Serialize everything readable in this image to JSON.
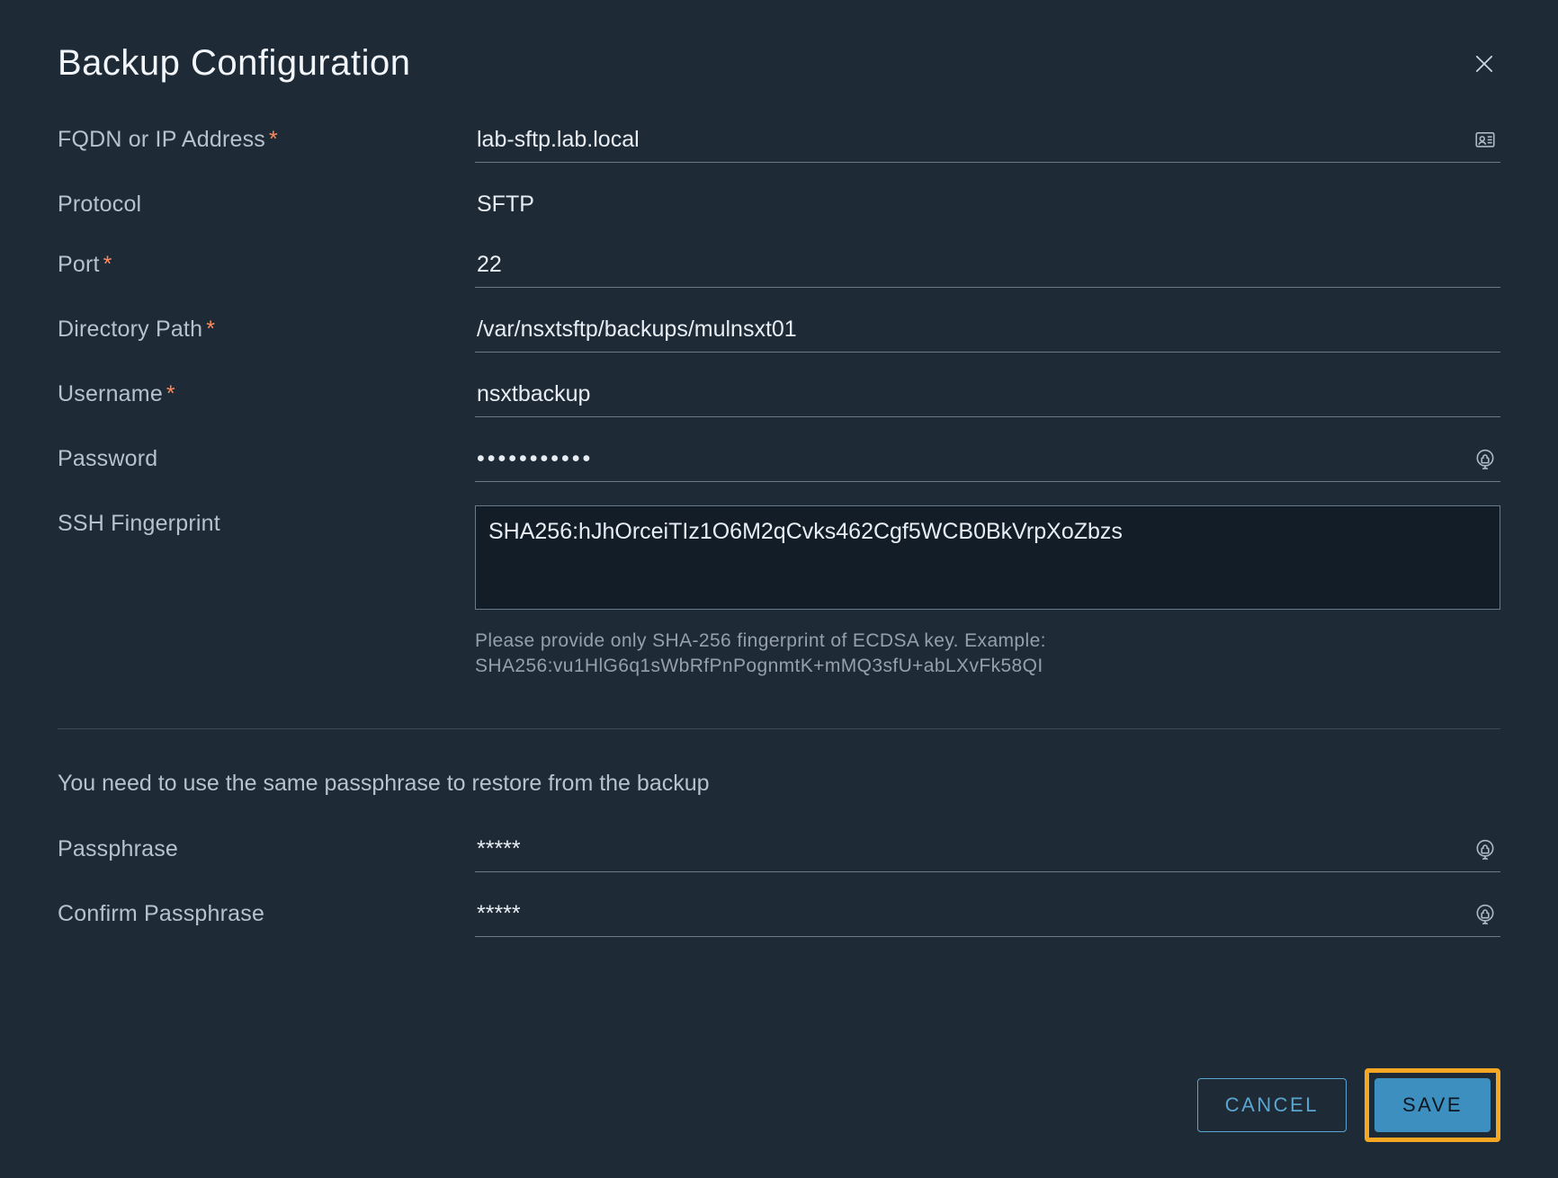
{
  "dialog": {
    "title": "Backup Configuration"
  },
  "fields": {
    "fqdn": {
      "label": "FQDN or IP Address",
      "required": true,
      "value": "lab-sftp.lab.local"
    },
    "protocol": {
      "label": "Protocol",
      "value": "SFTP"
    },
    "port": {
      "label": "Port",
      "required": true,
      "value": "22"
    },
    "directory_path": {
      "label": "Directory Path",
      "required": true,
      "value": "/var/nsxtsftp/backups/mulnsxt01"
    },
    "username": {
      "label": "Username",
      "required": true,
      "value": "nsxtbackup"
    },
    "password": {
      "label": "Password",
      "value_masked": "•••••••••••"
    },
    "ssh_fingerprint": {
      "label": "SSH Fingerprint",
      "value": "SHA256:hJhOrceiTIz1O6M2qCvks462Cgf5WCB0BkVrpXoZbzs",
      "helper_line1": "Please provide only SHA-256 fingerprint of ECDSA key. Example:",
      "helper_line2": "SHA256:vu1HlG6q1sWbRfPnPognmtK+mMQ3sfU+abLXvFk58QI"
    },
    "passphrase_note": "You need to use the same passphrase to restore from the backup",
    "passphrase": {
      "label": "Passphrase",
      "value_masked": "*****"
    },
    "confirm_passphrase": {
      "label": "Confirm Passphrase",
      "value_masked": "*****"
    }
  },
  "buttons": {
    "cancel": "CANCEL",
    "save": "SAVE"
  },
  "icons": {
    "close": "close-icon",
    "id_card": "id-card-icon",
    "password_reveal": "password-reveal-icon"
  }
}
